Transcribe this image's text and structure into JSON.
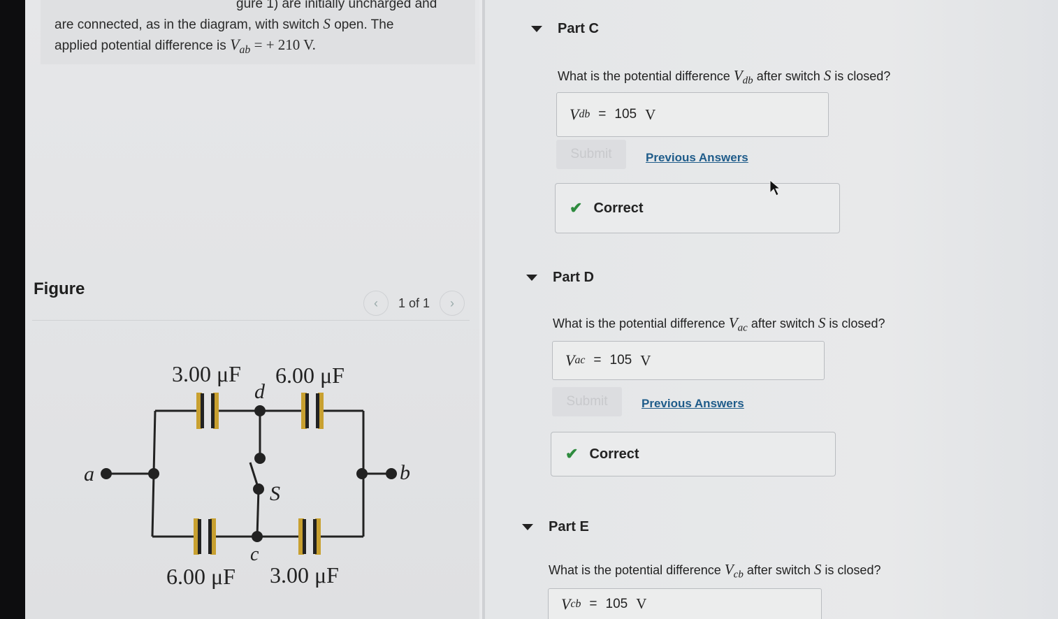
{
  "intro": {
    "line1": "gure 1) are initially uncharged and",
    "line2": "are connected, as in the diagram, with switch",
    "line2_var": "S",
    "line2_end": "open. The",
    "line3": "applied potential difference is",
    "line3_var": "V",
    "line3_sub": "ab",
    "line3_val": "= + 210 V."
  },
  "figure": {
    "title": "Figure",
    "pager": "1 of 1",
    "prev_icon": "chevron-left-icon",
    "next_icon": "chevron-right-icon",
    "labels": {
      "top_left_cap": "3.00 μF",
      "top_right_cap": "6.00 μF",
      "bottom_left_cap": "6.00 μF",
      "bottom_right_cap": "3.00 μF",
      "node_a": "a",
      "node_b": "b",
      "node_c": "c",
      "node_d": "d",
      "switch": "S"
    }
  },
  "parts": [
    {
      "title": "Part C",
      "q_pre": "What is the potential difference",
      "q_var": "V",
      "q_sub": "db",
      "q_mid": "after switch",
      "q_switch": "S",
      "q_post": "is closed?",
      "answer_var": "V",
      "answer_sub": "db",
      "answer_eq": "=",
      "answer_value": "105",
      "answer_unit": "V",
      "submit": "Submit",
      "previous": "Previous Answers",
      "feedback": "Correct"
    },
    {
      "title": "Part D",
      "q_pre": "What is the potential difference",
      "q_var": "V",
      "q_sub": "ac",
      "q_mid": "after switch",
      "q_switch": "S",
      "q_post": "is closed?",
      "answer_var": "V",
      "answer_sub": "ac",
      "answer_eq": "=",
      "answer_value": "105",
      "answer_unit": "V",
      "submit": "Submit",
      "previous": "Previous Answers",
      "feedback": "Correct"
    },
    {
      "title": "Part E",
      "q_pre": "What is the potential difference",
      "q_var": "V",
      "q_sub": "cb",
      "q_mid": "after switch",
      "q_switch": "S",
      "q_post": "is closed?",
      "answer_var": "V",
      "answer_sub": "cb",
      "answer_eq": "=",
      "answer_value": "105",
      "answer_unit": "V"
    }
  ],
  "colors": {
    "check": "#2e8b3e",
    "link": "#1f5c8a",
    "capacitor": "#c8a030"
  }
}
